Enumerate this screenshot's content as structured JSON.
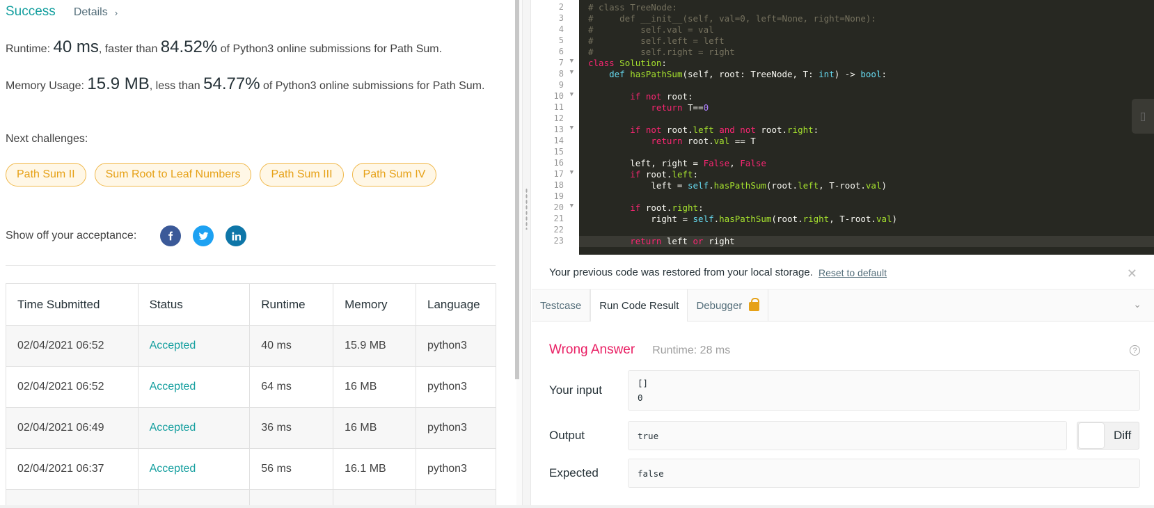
{
  "summary": {
    "status": "Success",
    "details_label": "Details",
    "runtime_label": "Runtime:",
    "runtime_value": "40 ms",
    "runtime_mid": ", faster than",
    "runtime_pct": "84.52%",
    "runtime_tail": "of Python3 online submissions for Path Sum.",
    "memory_label": "Memory Usage:",
    "memory_value": "15.9 MB",
    "memory_mid": ", less than",
    "memory_pct": "54.77%",
    "memory_tail": "of Python3 online submissions for Path Sum."
  },
  "next": {
    "label": "Next challenges:",
    "items": [
      "Path Sum II",
      "Sum Root to Leaf Numbers",
      "Path Sum III",
      "Path Sum IV"
    ]
  },
  "share": {
    "label": "Show off your acceptance:",
    "icons": [
      "facebook-icon",
      "twitter-icon",
      "linkedin-icon"
    ]
  },
  "table": {
    "headers": [
      "Time Submitted",
      "Status",
      "Runtime",
      "Memory",
      "Language"
    ],
    "rows": [
      [
        "02/04/2021 06:52",
        "Accepted",
        "40 ms",
        "15.9 MB",
        "python3"
      ],
      [
        "02/04/2021 06:52",
        "Accepted",
        "64 ms",
        "16 MB",
        "python3"
      ],
      [
        "02/04/2021 06:49",
        "Accepted",
        "36 ms",
        "16 MB",
        "python3"
      ],
      [
        "02/04/2021 06:37",
        "Accepted",
        "56 ms",
        "16.1 MB",
        "python3"
      ]
    ]
  },
  "editor": {
    "lines": [
      {
        "n": "2",
        "fold": false
      },
      {
        "n": "3",
        "fold": false
      },
      {
        "n": "4",
        "fold": false
      },
      {
        "n": "5",
        "fold": false
      },
      {
        "n": "6",
        "fold": false
      },
      {
        "n": "7",
        "fold": true
      },
      {
        "n": "8",
        "fold": true
      },
      {
        "n": "9",
        "fold": false
      },
      {
        "n": "10",
        "fold": true
      },
      {
        "n": "11",
        "fold": false
      },
      {
        "n": "12",
        "fold": false
      },
      {
        "n": "13",
        "fold": true
      },
      {
        "n": "14",
        "fold": false
      },
      {
        "n": "15",
        "fold": false
      },
      {
        "n": "16",
        "fold": false
      },
      {
        "n": "17",
        "fold": true
      },
      {
        "n": "18",
        "fold": false
      },
      {
        "n": "19",
        "fold": false
      },
      {
        "n": "20",
        "fold": true
      },
      {
        "n": "21",
        "fold": false
      },
      {
        "n": "22",
        "fold": false
      },
      {
        "n": "23",
        "fold": false
      }
    ]
  },
  "notice": {
    "text": "Your previous code was restored from your local storage.",
    "link": "Reset to default"
  },
  "tabs": {
    "testcase": "Testcase",
    "run_result": "Run Code Result",
    "debugger": "Debugger"
  },
  "result": {
    "verdict": "Wrong Answer",
    "runtime": "Runtime: 28 ms",
    "input_label": "Your input",
    "input_lines": [
      "[]",
      "0"
    ],
    "output_label": "Output",
    "output_value": "true",
    "diff_label": "Diff",
    "expected_label": "Expected",
    "expected_value": "false"
  },
  "colors": {
    "success": "#159f9f",
    "wrong": "#e91e63",
    "tag_text": "#e6a117",
    "editor_bg": "#272822"
  }
}
